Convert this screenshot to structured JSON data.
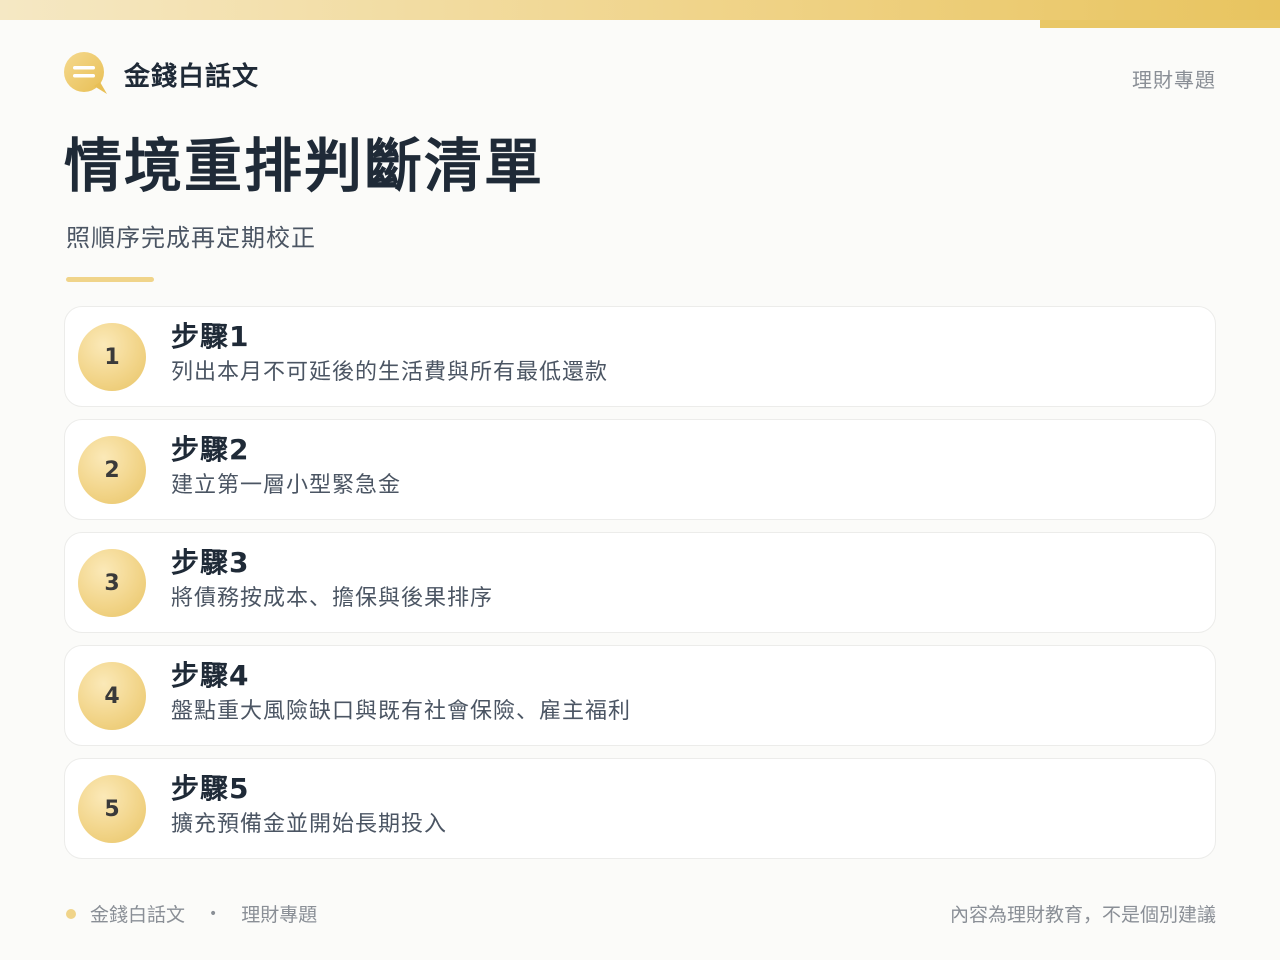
{
  "brand": {
    "name": "金錢白話文",
    "icon": "chat-bubble-icon"
  },
  "header": {
    "topic": "理財專題"
  },
  "title": "情境重排判斷清單",
  "subtitle": "照順序完成再定期校正",
  "steps": [
    {
      "number": "1",
      "title": "步驟1",
      "description": "列出本月不可延後的生活費與所有最低還款"
    },
    {
      "number": "2",
      "title": "步驟2",
      "description": "建立第一層小型緊急金"
    },
    {
      "number": "3",
      "title": "步驟3",
      "description": "將債務按成本、擔保與後果排序"
    },
    {
      "number": "4",
      "title": "步驟4",
      "description": "盤點重大風險缺口與既有社會保險、雇主福利"
    },
    {
      "number": "5",
      "title": "步驟5",
      "description": "擴充預備金並開始長期投入"
    }
  ],
  "footer": {
    "brand": "金錢白話文",
    "separator": "•",
    "topic": "理財專題",
    "disclaimer": "內容為理財教育，不是個別建議"
  },
  "colors": {
    "accent": "#f0d48a",
    "accent_dark": "#e8c45f",
    "text_primary": "#1f2a37",
    "text_muted": "#8a8f96"
  }
}
